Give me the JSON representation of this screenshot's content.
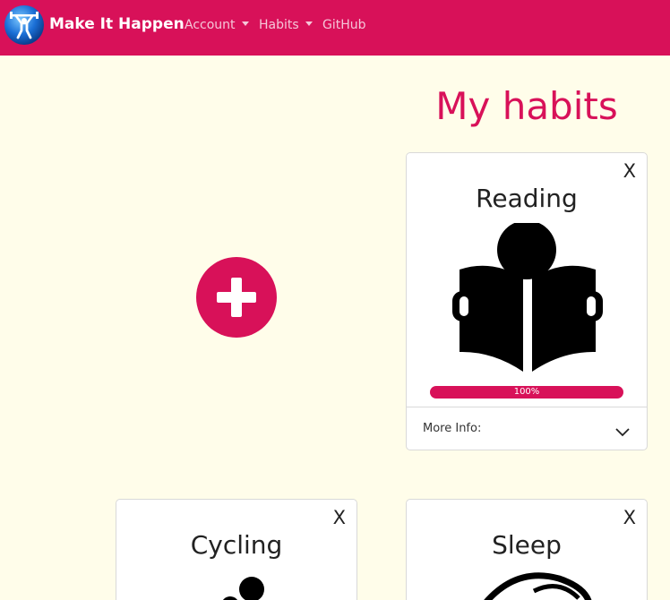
{
  "navbar": {
    "brand": "Make It Happen",
    "items": [
      {
        "label": "Account",
        "dropdown": true
      },
      {
        "label": "Habits",
        "dropdown": true
      },
      {
        "label": "GitHub",
        "dropdown": false
      }
    ],
    "colors": {
      "background": "#d81159",
      "link": "#f5c6d8"
    }
  },
  "page": {
    "title": "My habits",
    "background": "#fffdea"
  },
  "add_button": {
    "icon": "plus-icon",
    "color": "#d81159"
  },
  "habits": [
    {
      "name": "Reading",
      "icon": "reading-icon",
      "close_label": "X",
      "progress_value": 1.0,
      "progress_label": "100%",
      "footer_label": "More Info:"
    },
    {
      "name": "Cycling",
      "icon": "cycling-icon",
      "close_label": "X"
    },
    {
      "name": "Sleep",
      "icon": "sleep-icon",
      "close_label": "X"
    }
  ]
}
